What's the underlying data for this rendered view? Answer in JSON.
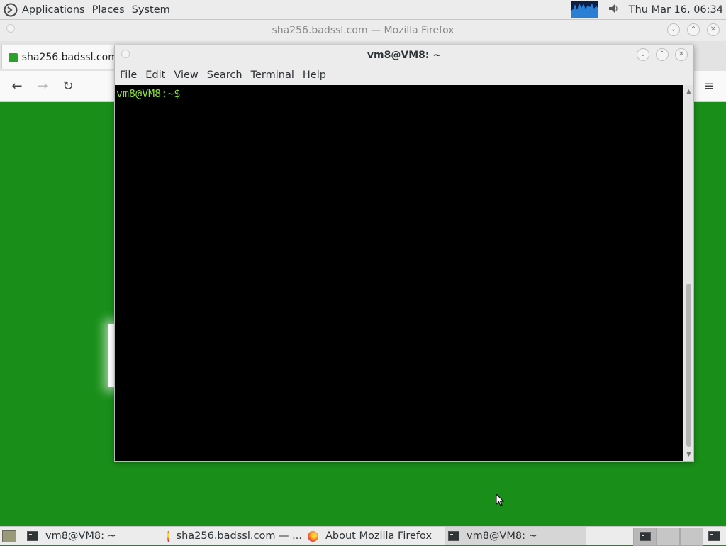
{
  "top_panel": {
    "menus": [
      "Applications",
      "Places",
      "System"
    ],
    "clock": "Thu Mar 16, 06:34"
  },
  "firefox": {
    "window_title": "sha256.badssl.com — Mozilla Firefox",
    "tab_label": "sha256.badssl.com",
    "page_bg": "#198f19"
  },
  "terminal": {
    "title": "vm8@VM8: ~",
    "menus": [
      "File",
      "Edit",
      "View",
      "Search",
      "Terminal",
      "Help"
    ],
    "prompt": "vm8@VM8:~$",
    "prompt_color": "#8ae234"
  },
  "taskbar": {
    "items": [
      {
        "label": "vm8@VM8: ~",
        "icon": "terminal-icon"
      },
      {
        "label": "sha256.badssl.com — ...",
        "icon": "firefox-icon"
      },
      {
        "label": "About Mozilla Firefox",
        "icon": "firefox-icon"
      },
      {
        "label": "vm8@VM8: ~",
        "icon": "terminal-icon"
      }
    ]
  }
}
